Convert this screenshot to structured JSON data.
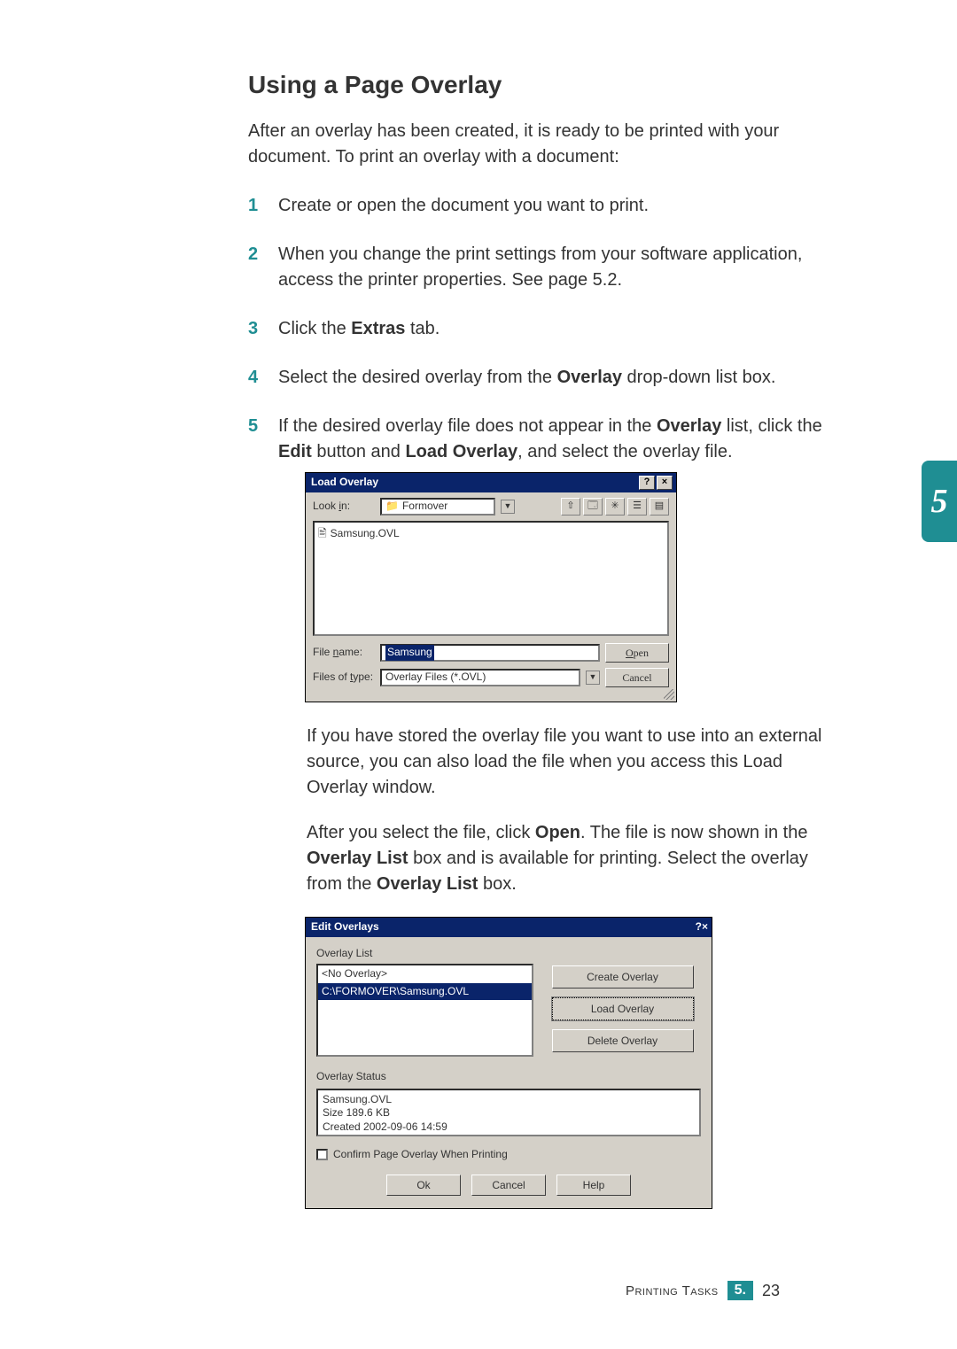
{
  "heading": "Using a Page Overlay",
  "intro": "After an overlay has been created, it is ready to be printed with your document. To print an overlay with a document:",
  "steps": {
    "s1": "Create or open the document you want to print.",
    "s2": "When you change the print settings from your software application, access the printer properties. See page 5.2.",
    "s3_a": "Click the ",
    "s3_b": "Extras",
    "s3_c": " tab.",
    "s4_a": "Select the desired overlay from the ",
    "s4_b": "Overlay",
    "s4_c": " drop-down list box.",
    "s5_a": "If the desired overlay file does not appear in the ",
    "s5_b": "Overlay",
    "s5_c": " list, click the ",
    "s5_d": "Edit",
    "s5_e": " button and ",
    "s5_f": "Load Overlay",
    "s5_g": ", and select the overlay file."
  },
  "nums": {
    "n1": "1",
    "n2": "2",
    "n3": "3",
    "n4": "4",
    "n5": "5"
  },
  "chapter": "5",
  "footer": {
    "label": "Printing Tasks",
    "chap": "5.",
    "page": "23"
  },
  "load_dlg": {
    "title": "Load Overlay",
    "help": "?",
    "close": "×",
    "lookin_label_pre": "Look ",
    "lookin_label_u": "i",
    "lookin_label_post": "n:",
    "lookin_value": "Formover",
    "file_item": "Samsung.OVL",
    "filename_label_pre": "File ",
    "filename_label_u": "n",
    "filename_label_post": "ame:",
    "filename_value": "Samsung",
    "filesoftype_pre": "Files of ",
    "filesoftype_u": "t",
    "filesoftype_post": "ype:",
    "filesoftype_value": "Overlay Files (*.OVL)",
    "open_u": "O",
    "open_post": "pen",
    "cancel": "Cancel"
  },
  "after1": "If you have stored the overlay file you want to use into an external source, you can also load the file when you access this Load Overlay window.",
  "after2_a": "After you select the file, click ",
  "after2_b": "Open",
  "after2_c": ". The file is now shown in the ",
  "after2_d": "Overlay List",
  "after2_e": " box and is available for printing. Select the overlay from the ",
  "after2_f": "Overlay List",
  "after2_g": " box.",
  "edit_dlg": {
    "title": "Edit Overlays",
    "help": "?",
    "close": "×",
    "list_label": "Overlay List",
    "item0": "<No Overlay>",
    "item1": "C:\\FORMOVER\\Samsung.OVL",
    "btn_create": "Create Overlay",
    "btn_load": "Load Overlay",
    "btn_delete": "Delete Overlay",
    "status_label": "Overlay Status",
    "status_line1": "Samsung.OVL",
    "status_line2": "Size 189.6 KB",
    "status_line3": "Created 2002-09-06 14:59",
    "confirm": "Confirm Page Overlay When Printing",
    "ok": "Ok",
    "cancel": "Cancel",
    "helpbtn": "Help"
  }
}
